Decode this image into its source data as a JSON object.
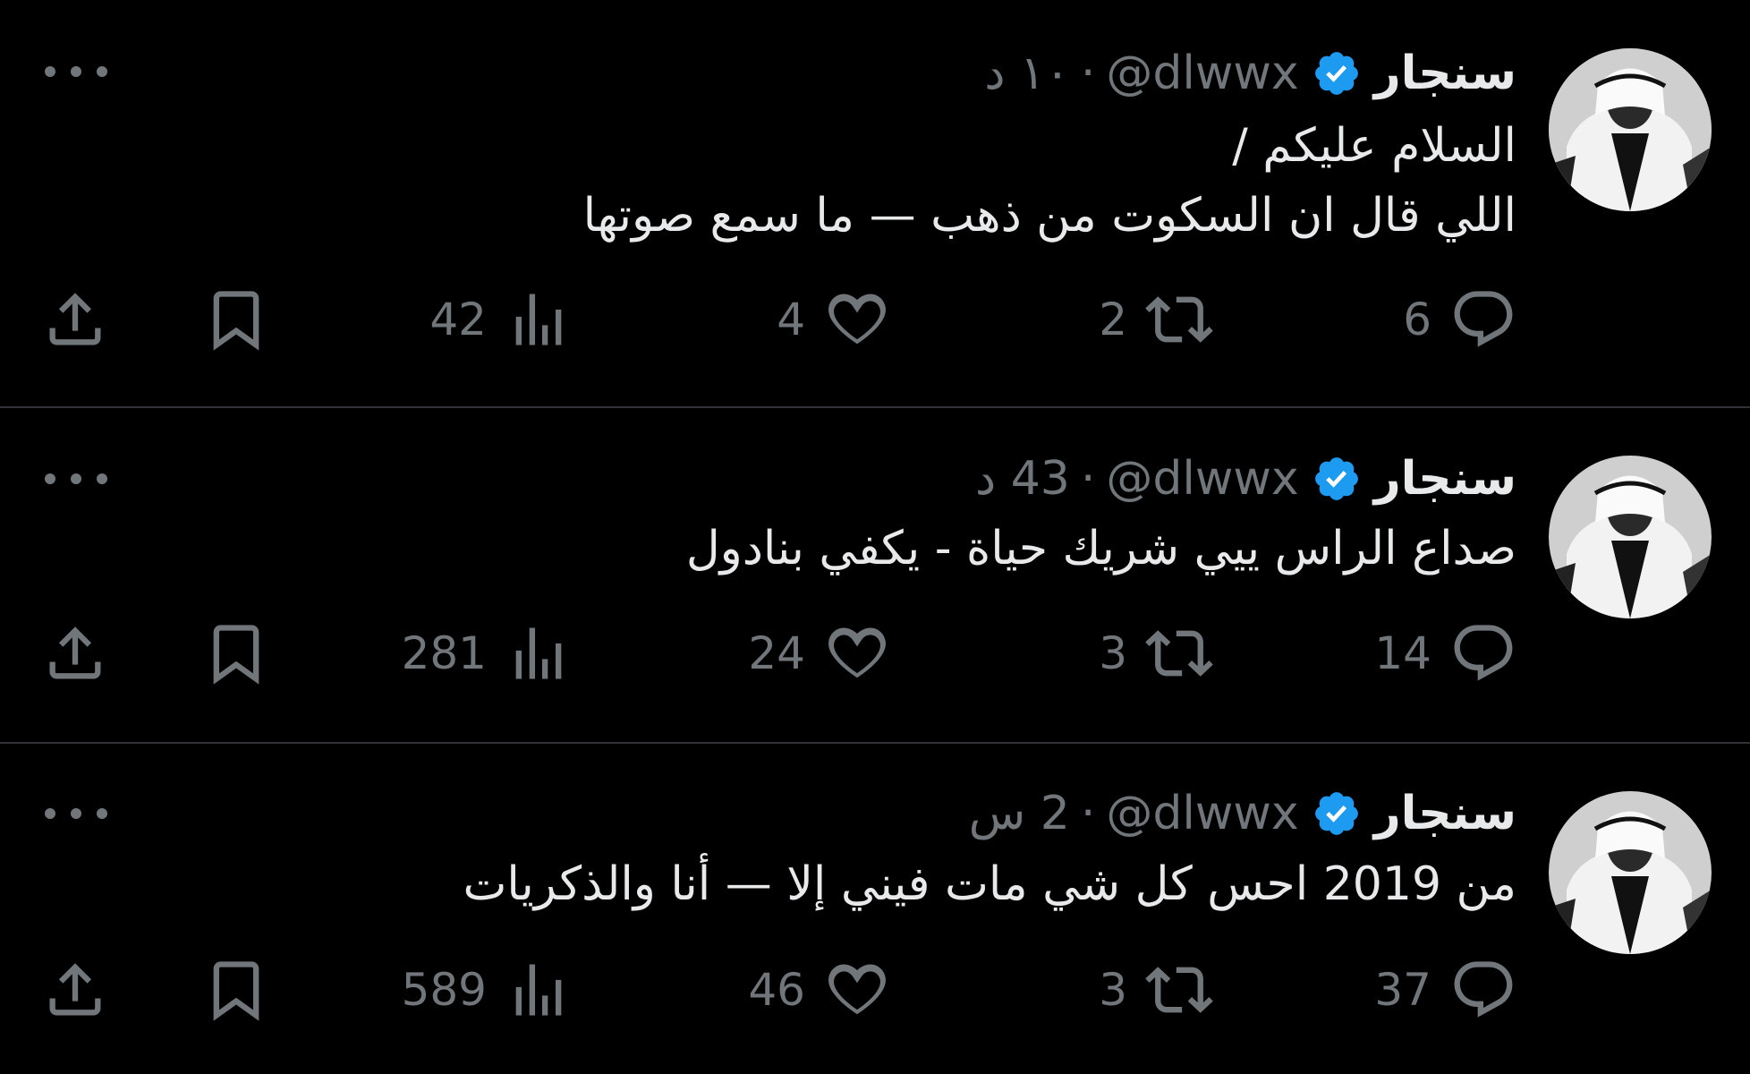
{
  "colors": {
    "background": "#000000",
    "text": "#e7e9ea",
    "muted": "#71767b",
    "divider": "#2f3336",
    "verified": "#1d9bf0"
  },
  "icons": {
    "reply": "reply-icon",
    "retweet": "retweet-icon",
    "like": "heart-icon",
    "views": "views-icon",
    "bookmark": "bookmark-icon",
    "share": "share-icon",
    "more": "more-icon",
    "verified": "verified-badge-icon"
  },
  "tweets": [
    {
      "name": "سنجار",
      "handle": "@dlwwx",
      "separator": "·",
      "time": "١٠ د",
      "lines": [
        "السلام عليكم /",
        "اللي قال ان السكوت من ذهب — ما سمع صوتها"
      ],
      "replies": "6",
      "retweets": "2",
      "likes": "4",
      "views": "42"
    },
    {
      "name": "سنجار",
      "handle": "@dlwwx",
      "separator": "·",
      "time": "43 د",
      "lines": [
        "صداع الراس ييي شريك حياة - يكفي بنادول"
      ],
      "replies": "14",
      "retweets": "3",
      "likes": "24",
      "views": "281"
    },
    {
      "name": "سنجار",
      "handle": "@dlwwx",
      "separator": "·",
      "time": "2 س",
      "lines": [
        "من 2019 احس كل شي مات فيني إلا — أنا والذكريات"
      ],
      "replies": "37",
      "retweets": "3",
      "likes": "46",
      "views": "589"
    }
  ]
}
